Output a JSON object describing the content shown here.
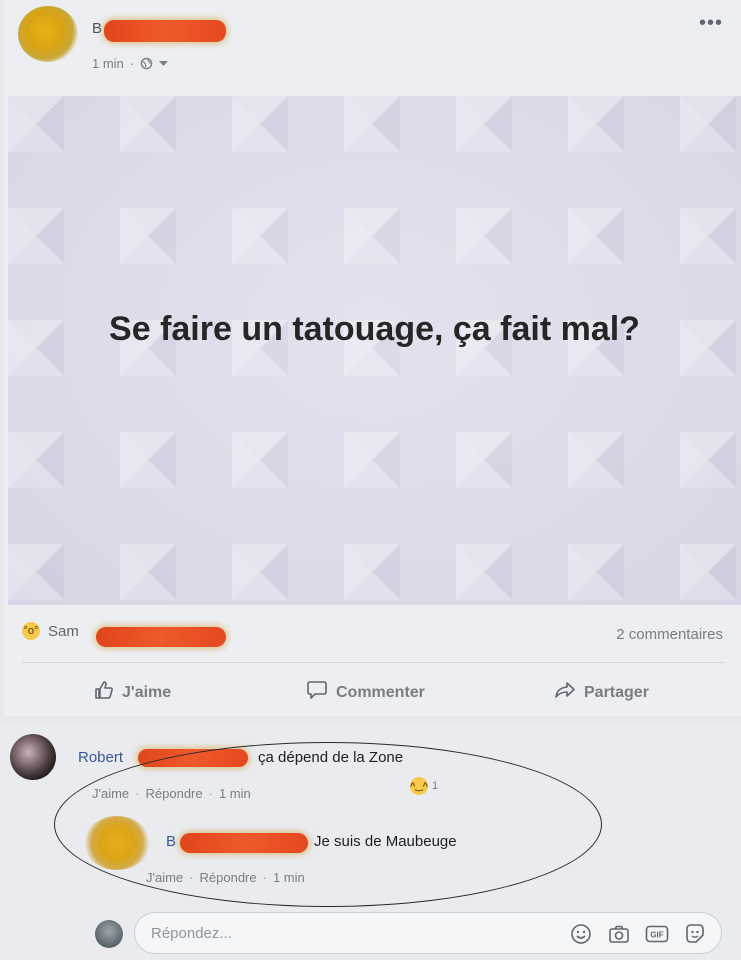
{
  "post": {
    "author_visible": "B",
    "time": "1 min",
    "more_label": "•••",
    "image_text": "Se faire un tatouage, ça fait mal?"
  },
  "stats": {
    "reactor_visible": "Sam",
    "comments_count": "2 commentaires"
  },
  "actions": {
    "like": "J'aime",
    "comment": "Commenter",
    "share": "Partager"
  },
  "comments": [
    {
      "name_visible": "Robert",
      "text": "ça dépend de la Zone",
      "like": "J'aime",
      "reply": "Répondre",
      "time": "1 min",
      "reaction_count": "1",
      "reaction_icon": "haha-icon"
    },
    {
      "name_visible": "B",
      "text": "Je suis de Maubeuge",
      "like": "J'aime",
      "reply": "Répondre",
      "time": "1 min"
    }
  ],
  "reply_box": {
    "placeholder": "Répondez..."
  },
  "icons": [
    "globe-icon",
    "caret-down-icon",
    "wow-reaction-icon",
    "thumbs-up-icon",
    "comment-bubble-icon",
    "share-arrow-icon",
    "haha-icon",
    "emoji-icon",
    "camera-icon",
    "gif-icon",
    "sticker-icon"
  ],
  "colors": {
    "name_link": "#385898",
    "redaction": "#e44820",
    "meta_text": "#7a7d83"
  }
}
